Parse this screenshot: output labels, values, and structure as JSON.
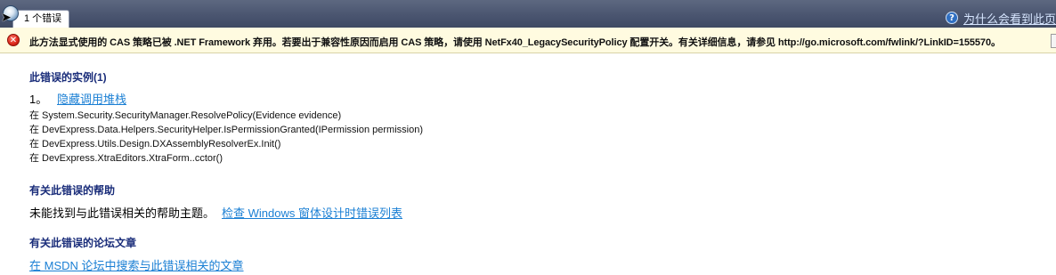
{
  "tab": {
    "label": "1 个错误"
  },
  "header": {
    "help_link": "为什么会看到此页",
    "help_icon": "question-icon"
  },
  "message": {
    "icon": "error-icon",
    "text": "此方法显式使用的 CAS 策略已被 .NET Framework 弃用。若要出于兼容性原因而启用 CAS 策略，请使用 NetFx40_LegacySecurityPolicy 配置开关。有关详细信息，请参见 http://go.microsoft.com/fwlink/?LinkID=155570。"
  },
  "instances": {
    "heading": "此错误的实例(1)",
    "items": [
      {
        "number": "1。",
        "toggle_label": "隐藏调用堆栈",
        "stack": [
          "在 System.Security.SecurityManager.ResolvePolicy(Evidence evidence)",
          "在 DevExpress.Data.Helpers.SecurityHelper.IsPermissionGranted(IPermission permission)",
          "在 DevExpress.Utils.Design.DXAssemblyResolverEx.Init()",
          "在 DevExpress.XtraEditors.XtraForm..cctor()"
        ]
      }
    ]
  },
  "help": {
    "heading": "有关此错误的帮助",
    "text": "未能找到与此错误相关的帮助主题。",
    "link": "检查 Windows 窗体设计时错误列表"
  },
  "forum": {
    "heading": "有关此错误的论坛文章",
    "link": "在 MSDN 论坛中搜索与此错误相关的文章"
  },
  "colors": {
    "header_bg": "#4a5570",
    "message_bg": "#fffbe0",
    "heading": "#1a2d7a",
    "link": "#1a7fd4",
    "error": "#d9261a"
  }
}
